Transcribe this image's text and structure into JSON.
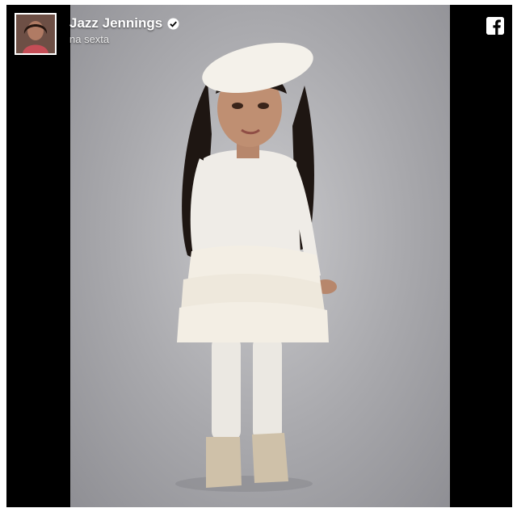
{
  "post": {
    "page_name": "Jazz Jennings",
    "timestamp": "na sexta",
    "verified": true
  },
  "icons": {
    "avatar": "profile-avatar",
    "verified": "verified-check-icon",
    "brand": "facebook-icon"
  },
  "colors": {
    "frame_background": "#000000",
    "photo_background": "#b4b4b8",
    "text": "#ffffff"
  }
}
